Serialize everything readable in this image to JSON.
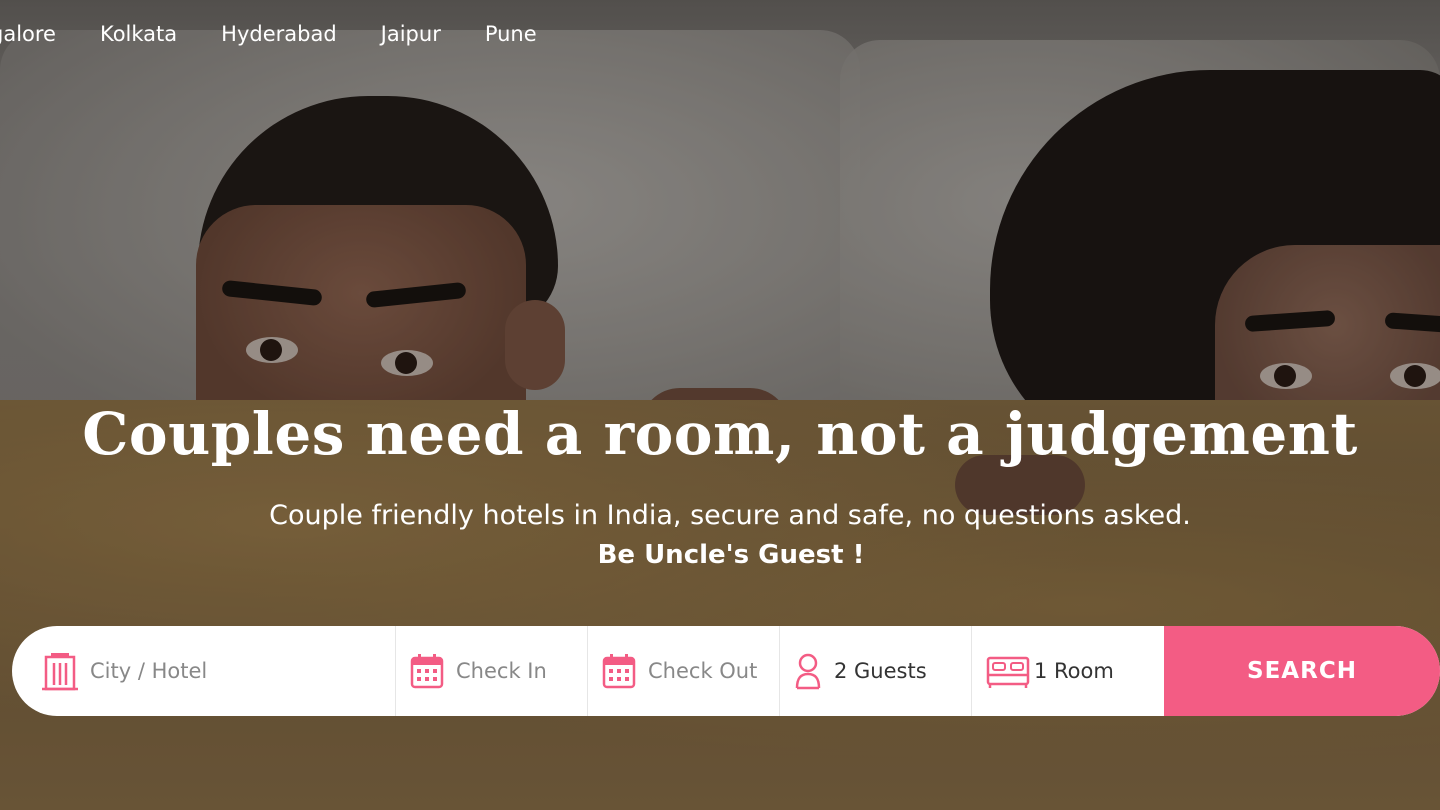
{
  "nav": {
    "cities": [
      "galore",
      "Kolkata",
      "Hyderabad",
      "Jaipur",
      "Pune"
    ]
  },
  "hero": {
    "headline": "Couples need a room, not a judgement",
    "subline": "Couple friendly hotels in India, secure and safe, no questions asked.",
    "tagline": "Be Uncle's Guest !"
  },
  "search": {
    "city_placeholder": "City / Hotel",
    "check_in": "Check In",
    "check_out": "Check Out",
    "guests": "2 Guests",
    "rooms": "1 Room",
    "button": "SEARCH",
    "icons": {
      "city": "hotel-building-icon",
      "check_in": "calendar-icon",
      "check_out": "calendar-icon",
      "guests": "person-icon",
      "rooms": "bed-icon"
    }
  },
  "colors": {
    "accent": "#f35c84",
    "white": "#ffffff"
  }
}
